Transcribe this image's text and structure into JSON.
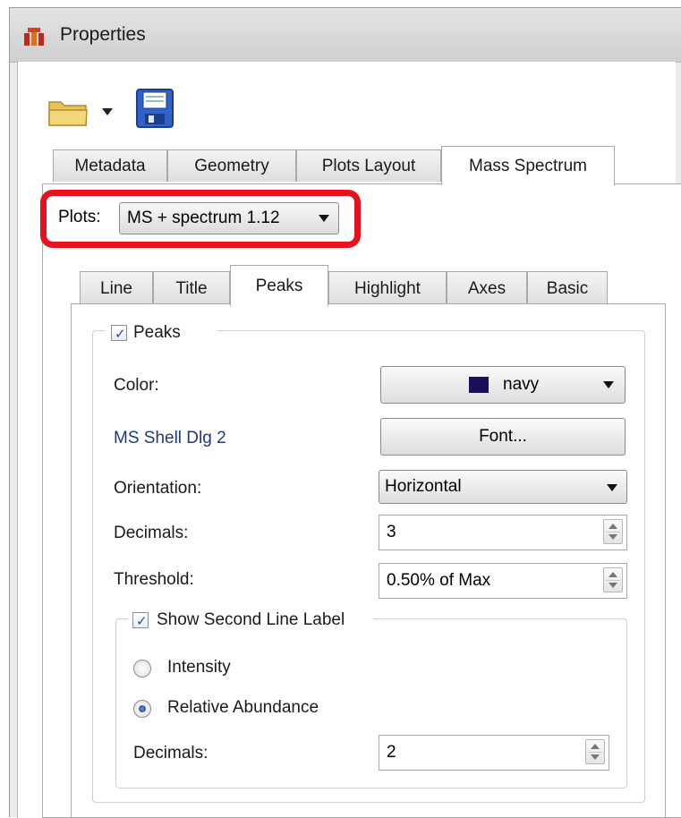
{
  "window": {
    "title": "Properties"
  },
  "toolbar": {
    "open_icon": "folder-icon",
    "save_icon": "save-icon"
  },
  "tabs": [
    {
      "label": "Metadata",
      "active": false
    },
    {
      "label": "Geometry",
      "active": false
    },
    {
      "label": "Plots Layout",
      "active": false
    },
    {
      "label": "Mass Spectrum",
      "active": true
    }
  ],
  "plots": {
    "label": "Plots:",
    "value": "MS + spectrum 1.12"
  },
  "subtabs": [
    {
      "label": "Line",
      "active": false
    },
    {
      "label": "Title",
      "active": false
    },
    {
      "label": "Peaks",
      "active": true
    },
    {
      "label": "Highlight",
      "active": false
    },
    {
      "label": "Axes",
      "active": false
    },
    {
      "label": "Basic",
      "active": false
    }
  ],
  "peaks": {
    "group_label": "Peaks",
    "checked": true,
    "color_label": "Color:",
    "color_value": "navy",
    "color_hex": "#1b0f5c",
    "font_label": "MS Shell Dlg 2",
    "font_button": "Font...",
    "orientation_label": "Orientation:",
    "orientation_value": "Horizontal",
    "decimals_label": "Decimals:",
    "decimals_value": "3",
    "threshold_label": "Threshold:",
    "threshold_value": "0.50% of Max"
  },
  "second_line": {
    "group_label": "Show Second Line Label",
    "checked": true,
    "intensity_label": "Intensity",
    "relative_label": "Relative Abundance",
    "selected": "Relative Abundance",
    "decimals_label": "Decimals:",
    "decimals_value": "2"
  },
  "colors": {
    "highlight": "#e8121c"
  }
}
